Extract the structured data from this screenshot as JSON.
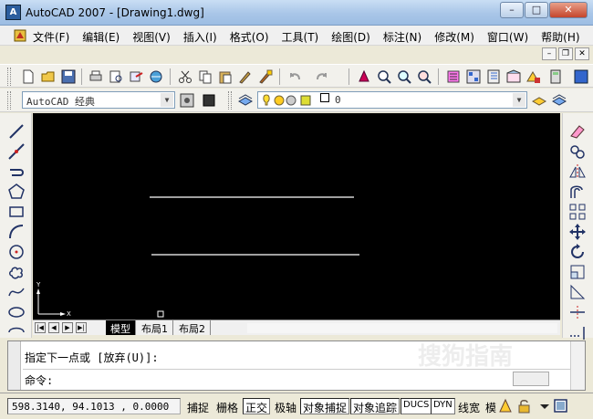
{
  "window": {
    "title": "AutoCAD 2007 - [Drawing1.dwg]",
    "app_icon": "A",
    "minimize": "–",
    "maximize": "□",
    "close": "✕"
  },
  "menu": {
    "items": [
      "文件(F)",
      "编辑(E)",
      "视图(V)",
      "插入(I)",
      "格式(O)",
      "工具(T)",
      "绘图(D)",
      "标注(N)",
      "修改(M)",
      "窗口(W)",
      "帮助(H)"
    ]
  },
  "mdi": {
    "minimize": "–",
    "restore": "❐",
    "close": "✕"
  },
  "workspace": {
    "value": "AutoCAD 经典"
  },
  "layer": {
    "value": "0"
  },
  "tabs": [
    "模型",
    "布局1",
    "布局2"
  ],
  "ucs": {
    "y": "Y",
    "x": "X"
  },
  "command": {
    "history": "指定下一点或 [放弃(U)]:",
    "prompt": "命令:"
  },
  "status": {
    "coords": "598.3140,  94.1013 , 0.0000",
    "toggles": [
      {
        "label": "捕捉",
        "on": false
      },
      {
        "label": "栅格",
        "on": false
      },
      {
        "label": "正交",
        "on": true
      },
      {
        "label": "极轴",
        "on": false
      },
      {
        "label": "对象捕捉",
        "on": true
      },
      {
        "label": "对象追踪",
        "on": true
      },
      {
        "label": "DUCS",
        "on": true
      },
      {
        "label": "DYN",
        "on": true
      },
      {
        "label": "线宽",
        "on": false
      },
      {
        "label": "模",
        "on": false
      }
    ]
  },
  "watermark": "搜狗指南",
  "colors": {
    "canvas": "#000000",
    "line": "#ffffff"
  }
}
